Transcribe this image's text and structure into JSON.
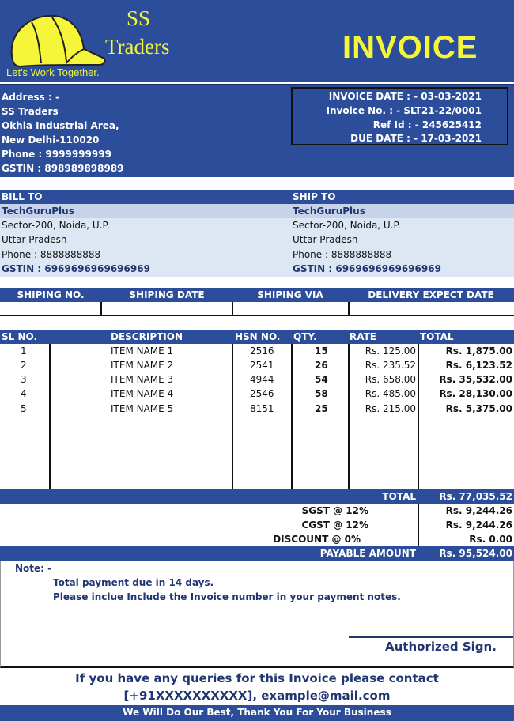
{
  "colors": {
    "brand_blue": "#2c4d9a",
    "accent_yellow": "#f5f53a",
    "light_blue": "#dde6f3"
  },
  "company": {
    "name_line1": "SS",
    "name_line2": "Traders",
    "tagline": "Let's Work Together.",
    "logo_icon": "cap-icon"
  },
  "invoice_title": "INVOICE",
  "seller": {
    "address_label": "Address : -",
    "lines": [
      "SS Traders",
      "Okhla Industrial Area,",
      "New Delhi-110020",
      "Phone : 9999999999",
      "GSTIN : 898989898989"
    ]
  },
  "invoice_meta": {
    "date": "INVOICE DATE : - 03-03-2021",
    "number": "Invoice No. : - SLT21-22/0001",
    "ref": "Ref Id : - 245625412",
    "due": "DUE DATE : - 17-03-2021"
  },
  "bill_to": {
    "label": "BILL TO",
    "name": "TechGuruPlus",
    "address1": "Sector-200, Noida, U.P.",
    "address2": "Uttar Pradesh",
    "phone": "Phone : 8888888888",
    "gstin": "GSTIN : 6969696969696969"
  },
  "ship_to": {
    "label": "SHIP TO",
    "name": "TechGuruPlus",
    "address1": "Sector-200, Noida, U.P.",
    "address2": "Uttar Pradesh",
    "phone": "Phone : 8888888888",
    "gstin": "GSTIN : 6969696969696969"
  },
  "shipping_headers": [
    "SHIPING NO.",
    "SHIPING DATE",
    "SHIPING VIA",
    "DELIVERY EXPECT DATE"
  ],
  "item_headers": {
    "sl": "SL NO.",
    "desc": "DESCRIPTION",
    "hsn": "HSN NO.",
    "qty": "QTY.",
    "rate": "RATE",
    "total": "TOTAL"
  },
  "items": [
    {
      "sl": "1",
      "desc": "ITEM NAME 1",
      "hsn": "2516",
      "qty": "15",
      "rate": "Rs. 125.00",
      "total": "Rs. 1,875.00"
    },
    {
      "sl": "2",
      "desc": "ITEM NAME 2",
      "hsn": "2541",
      "qty": "26",
      "rate": "Rs. 235.52",
      "total": "Rs. 6,123.52"
    },
    {
      "sl": "3",
      "desc": "ITEM NAME 3",
      "hsn": "4944",
      "qty": "54",
      "rate": "Rs. 658.00",
      "total": "Rs. 35,532.00"
    },
    {
      "sl": "4",
      "desc": "ITEM NAME 4",
      "hsn": "2546",
      "qty": "58",
      "rate": "Rs. 485.00",
      "total": "Rs. 28,130.00"
    },
    {
      "sl": "5",
      "desc": "ITEM NAME 5",
      "hsn": "8151",
      "qty": "25",
      "rate": "Rs. 215.00",
      "total": "Rs. 5,375.00"
    }
  ],
  "totals": {
    "total_label": "TOTAL",
    "total_value": "Rs. 77,035.52",
    "sgst_label": "SGST @  12%",
    "sgst_value": "Rs. 9,244.26",
    "cgst_label": "CGST @  12%",
    "cgst_value": "Rs. 9,244.26",
    "discount_label": "DISCOUNT @  0%",
    "discount_value": "Rs. 0.00",
    "payable_label": "PAYABLE AMOUNT",
    "payable_value": "Rs. 95,524.00"
  },
  "notes": {
    "label": "Note: -",
    "line1": "Total payment due in 14 days.",
    "line2": "Please inclue Include the Invoice number in your payment notes."
  },
  "signature_label": "Authorized Sign.",
  "footer": {
    "query": "If you have any queries for this Invoice  please contact",
    "contact": "[+91XXXXXXXXXX], example@mail.com",
    "banner": "We Will Do Our Best, Thank You For Your Business"
  }
}
